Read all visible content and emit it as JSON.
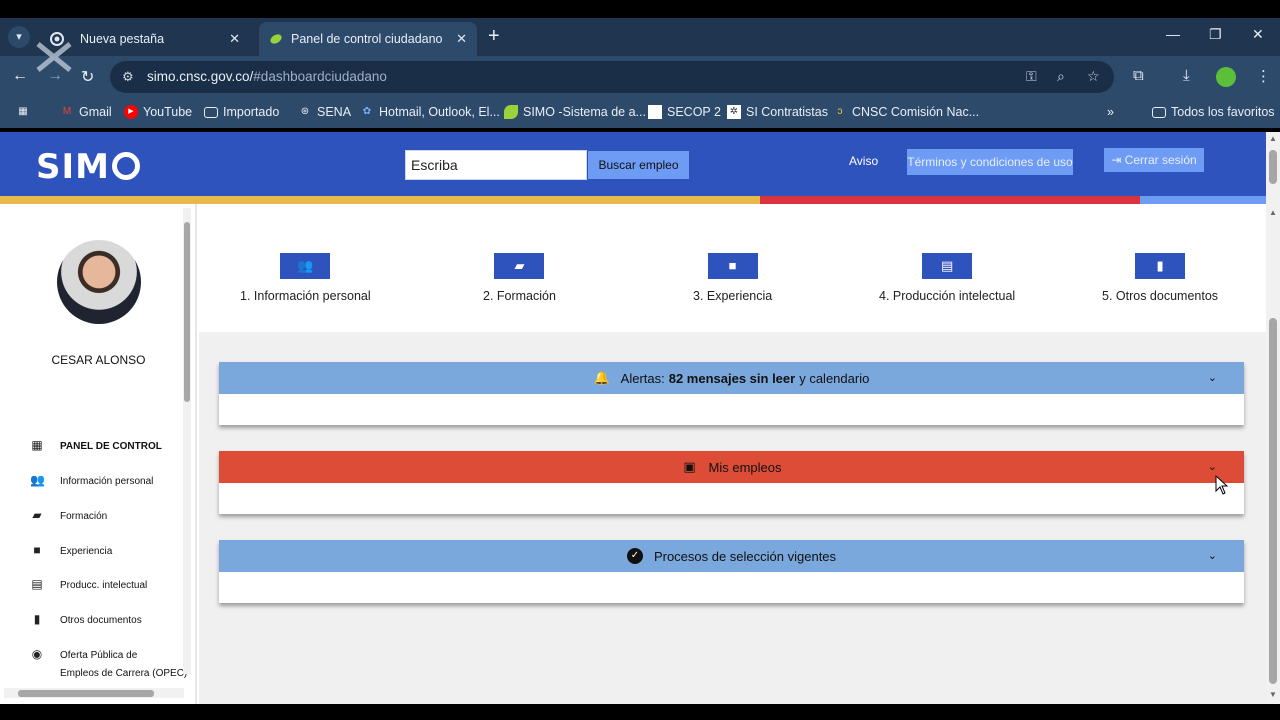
{
  "browser": {
    "tabs": [
      {
        "title": "Nueva pestaña",
        "active": false
      },
      {
        "title": "Panel de control ciudadano",
        "active": true
      }
    ],
    "url_host": "simo.cnsc.gov.co/",
    "url_path": "#dashboardciudadano",
    "bookmarks": [
      {
        "label": "Gmail",
        "icon": "gmail-icon"
      },
      {
        "label": "YouTube",
        "icon": "youtube-icon"
      },
      {
        "label": "Importado",
        "icon": "folder-icon"
      },
      {
        "label": "SENA",
        "icon": "sena-icon"
      },
      {
        "label": "Hotmail, Outlook, El...",
        "icon": "hotmail-icon"
      },
      {
        "label": "SIMO -Sistema de a...",
        "icon": "simo-leaf-icon"
      },
      {
        "label": "SECOP 2",
        "icon": "secop-icon"
      },
      {
        "label": "SI Contratistas",
        "icon": "sicontratistas-icon"
      },
      {
        "label": "CNSC Comisión Nac...",
        "icon": "cnsc-icon"
      }
    ],
    "all_bookmarks": "Todos los favoritos"
  },
  "header": {
    "logo": "SIM",
    "search_value": "Escriba",
    "search_button": "Buscar empleo",
    "aviso": "Aviso",
    "terms_button": "Términos y condiciones de uso",
    "logout_button": "Cerrar sesión",
    "colors": {
      "header": "#2f53bd",
      "bar_yellow": "#e9b84a",
      "bar_red": "#d8343d",
      "bar_blue": "#6e9cf4"
    }
  },
  "sidebar": {
    "user_name": "CESAR ALONSO",
    "items": [
      {
        "label": "PANEL DE CONTROL",
        "icon": "dashboard-icon"
      },
      {
        "label": "Información personal",
        "icon": "people-icon"
      },
      {
        "label": "Formación",
        "icon": "book-icon"
      },
      {
        "label": "Experiencia",
        "icon": "briefcase-icon"
      },
      {
        "label": "Producc. intelectual",
        "icon": "newspaper-icon"
      },
      {
        "label": "Otros documentos",
        "icon": "document-icon"
      },
      {
        "label": "Oferta Pública de",
        "label2": "Empleos de Carrera (OPEC)",
        "icon": "globe-icon"
      }
    ]
  },
  "steps": [
    {
      "label": "1. Información personal",
      "icon": "people-icon"
    },
    {
      "label": "2. Formación",
      "icon": "book-icon"
    },
    {
      "label": "3. Experiencia",
      "icon": "briefcase-icon"
    },
    {
      "label": "4. Producción intelectual",
      "icon": "newspaper-icon"
    },
    {
      "label": "5. Otros documentos",
      "icon": "document-icon"
    }
  ],
  "panels": {
    "alerts": {
      "prefix": "Alertas:",
      "bold": "82 mensajes sin leer",
      "suffix": "y calendario",
      "color": "#7aa7dc"
    },
    "jobs": {
      "title": "Mis empleos",
      "color": "#dd4c36"
    },
    "processes": {
      "title": "Procesos de selección vigentes",
      "color": "#7aa7dc"
    }
  }
}
